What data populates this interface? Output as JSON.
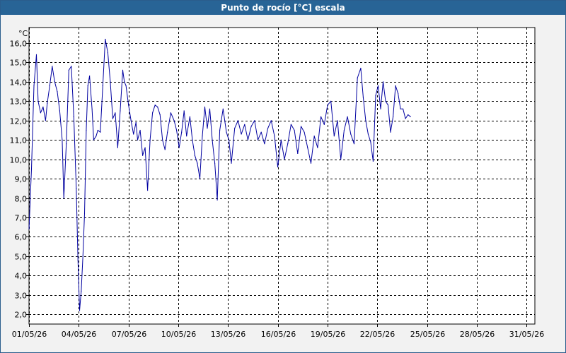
{
  "window": {
    "title": "Punto de rocío [°C] escala"
  },
  "chart_data": {
    "type": "line",
    "title": "Punto de rocío [°C] escala",
    "ylabel": "°C",
    "xlabel": "",
    "ylim": [
      1.5,
      16.8
    ],
    "xlim": [
      0,
      30.5
    ],
    "grid": true,
    "y_ticks": [
      2.0,
      3.0,
      4.0,
      5.0,
      6.0,
      7.0,
      8.0,
      9.0,
      10.0,
      11.0,
      12.0,
      13.0,
      14.0,
      15.0,
      16.0
    ],
    "y_tick_labels": [
      "2,0",
      "3,0",
      "4,0",
      "5,0",
      "6,0",
      "7,0",
      "8,0",
      "9,0",
      "10,0",
      "11,0",
      "12,0",
      "13,0",
      "14,0",
      "15,0",
      "16,0"
    ],
    "x_ticks": [
      0,
      3,
      6,
      9,
      12,
      15,
      18,
      21,
      24,
      27,
      30
    ],
    "x_tick_labels": [
      "01/05/26",
      "04/05/26",
      "07/05/26",
      "10/05/26",
      "13/05/26",
      "16/05/26",
      "19/05/26",
      "22/05/26",
      "25/05/26",
      "28/05/26",
      "31/05/26"
    ],
    "line_color": "#0000a0",
    "series": [
      {
        "x": [
          0,
          0.15,
          0.3,
          0.45,
          0.55,
          0.7,
          0.85,
          1.0,
          1.1,
          1.25,
          1.4,
          1.55,
          1.7,
          1.85,
          2.0,
          2.1,
          2.25,
          2.4,
          2.55,
          2.7,
          2.85,
          2.95,
          3.05,
          3.15,
          3.25,
          3.35,
          3.45,
          3.55,
          3.65,
          3.8,
          3.9,
          4.05,
          4.15,
          4.3,
          4.45,
          4.6,
          4.75,
          4.9,
          5.05,
          5.2,
          5.35,
          5.5,
          5.65,
          5.75,
          5.85,
          6.0,
          6.15,
          6.3,
          6.45,
          6.55,
          6.7,
          6.85,
          7.0,
          7.15,
          7.3,
          7.45,
          7.6,
          7.75,
          7.9,
          8.05,
          8.2,
          8.35,
          8.55,
          8.75,
          8.9,
          9.05,
          9.2,
          9.35,
          9.5,
          9.7,
          9.85,
          10.0,
          10.15,
          10.3,
          10.45,
          10.6,
          10.75,
          10.9,
          11.05,
          11.2,
          11.35,
          11.5,
          11.7,
          11.9,
          12.05,
          12.2,
          12.4,
          12.6,
          12.8,
          13.0,
          13.2,
          13.4,
          13.6,
          13.8,
          14.0,
          14.2,
          14.4,
          14.6,
          14.8,
          15.0,
          15.2,
          15.4,
          15.6,
          15.8,
          16.0,
          16.2,
          16.4,
          16.6,
          16.8,
          17.0,
          17.2,
          17.4,
          17.6,
          17.8,
          18.0,
          18.2,
          18.4,
          18.6,
          18.8,
          19.0,
          19.2,
          19.4,
          19.6,
          19.8,
          20.0,
          20.15,
          20.3,
          20.45,
          20.6,
          20.75,
          20.9,
          21.05,
          21.2,
          21.35,
          21.5,
          21.65,
          21.8,
          21.95,
          22.1,
          22.25,
          22.4,
          22.55,
          22.7,
          22.85,
          23.0
        ],
        "y": [
          6.4,
          9.5,
          13.8,
          15.4,
          13.0,
          12.4,
          12.7,
          12.0,
          12.9,
          13.8,
          14.8,
          14.0,
          13.5,
          12.5,
          11.0,
          8.0,
          10.8,
          14.6,
          14.8,
          12.2,
          8.5,
          4.8,
          2.2,
          3.2,
          5.0,
          7.2,
          11.5,
          13.8,
          14.3,
          12.6,
          11.0,
          11.2,
          11.5,
          11.4,
          13.8,
          16.2,
          15.5,
          14.0,
          12.1,
          12.4,
          10.6,
          12.5,
          14.6,
          14.0,
          13.8,
          12.8,
          12.0,
          11.3,
          11.9,
          11.0,
          11.5,
          10.2,
          10.6,
          8.4,
          11.0,
          12.4,
          12.8,
          12.7,
          12.3,
          11.0,
          10.5,
          11.4,
          12.4,
          12.0,
          11.5,
          10.6,
          11.4,
          12.5,
          11.2,
          12.2,
          11.0,
          10.2,
          9.8,
          9.0,
          11.2,
          12.7,
          11.6,
          12.6,
          11.0,
          9.8,
          7.9,
          11.5,
          12.6,
          11.4,
          11.0,
          9.8,
          11.6,
          12.0,
          11.3,
          11.8,
          11.0,
          11.7,
          12.0,
          11.0,
          11.4,
          10.8,
          11.6,
          12.0,
          11.2,
          9.6,
          11.0,
          10.0,
          10.8,
          11.8,
          11.5,
          10.3,
          11.7,
          11.4,
          10.6,
          9.8,
          11.2,
          10.6,
          12.2,
          11.8,
          12.8,
          13.0,
          11.2,
          12.0,
          10.0,
          11.5,
          12.2,
          11.3,
          10.8,
          14.2,
          14.7,
          13.2,
          12.0,
          11.3,
          10.9,
          9.9,
          13.3,
          13.8,
          12.6,
          14.0,
          13.0,
          12.8,
          11.4,
          12.2,
          13.8,
          13.4,
          12.6,
          12.6,
          12.1,
          12.3,
          12.2
        ]
      }
    ]
  }
}
